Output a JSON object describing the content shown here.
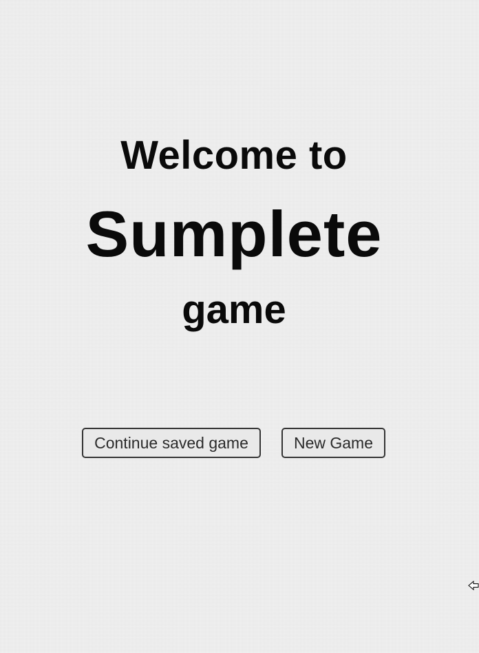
{
  "welcome": {
    "line1": "Welcome to",
    "title": "Sumplete",
    "line3": "game"
  },
  "buttons": {
    "continue_label": "Continue saved game",
    "new_game_label": "New Game"
  },
  "colors": {
    "background": "#ececec",
    "text": "#0a0a0a",
    "button_border": "#333333",
    "button_bg": "#e9e9e9"
  },
  "icons": {
    "cursor": "arrow-cursor-icon"
  }
}
